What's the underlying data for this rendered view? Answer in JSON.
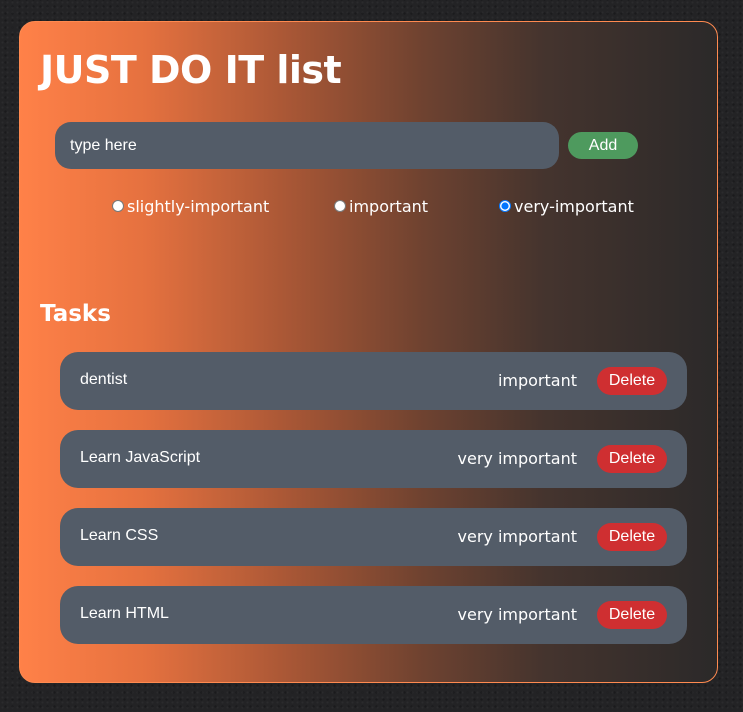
{
  "app": {
    "title": "JUST DO IT list"
  },
  "form": {
    "input_placeholder": "type here",
    "input_value": "",
    "add_label": "Add",
    "priorities": [
      {
        "label": "slightly-important",
        "checked": false
      },
      {
        "label": "important",
        "checked": false
      },
      {
        "label": "very-important",
        "checked": true
      }
    ]
  },
  "tasks_section": {
    "heading": "Tasks",
    "items": [
      {
        "name": "dentist",
        "priority": "important",
        "delete_label": "Delete"
      },
      {
        "name": "Learn JavaScript",
        "priority": "very important",
        "delete_label": "Delete"
      },
      {
        "name": "Learn CSS",
        "priority": "very important",
        "delete_label": "Delete"
      },
      {
        "name": "Learn HTML",
        "priority": "very important",
        "delete_label": "Delete"
      }
    ]
  },
  "colors": {
    "gradient_start": "#ff8148",
    "gradient_end": "#2b2929",
    "card_border": "#ff8a50",
    "field_bg": "#535c68",
    "add_button": "#4e9a5e",
    "delete_button": "#cf2f31",
    "page_bg": "#232325"
  }
}
